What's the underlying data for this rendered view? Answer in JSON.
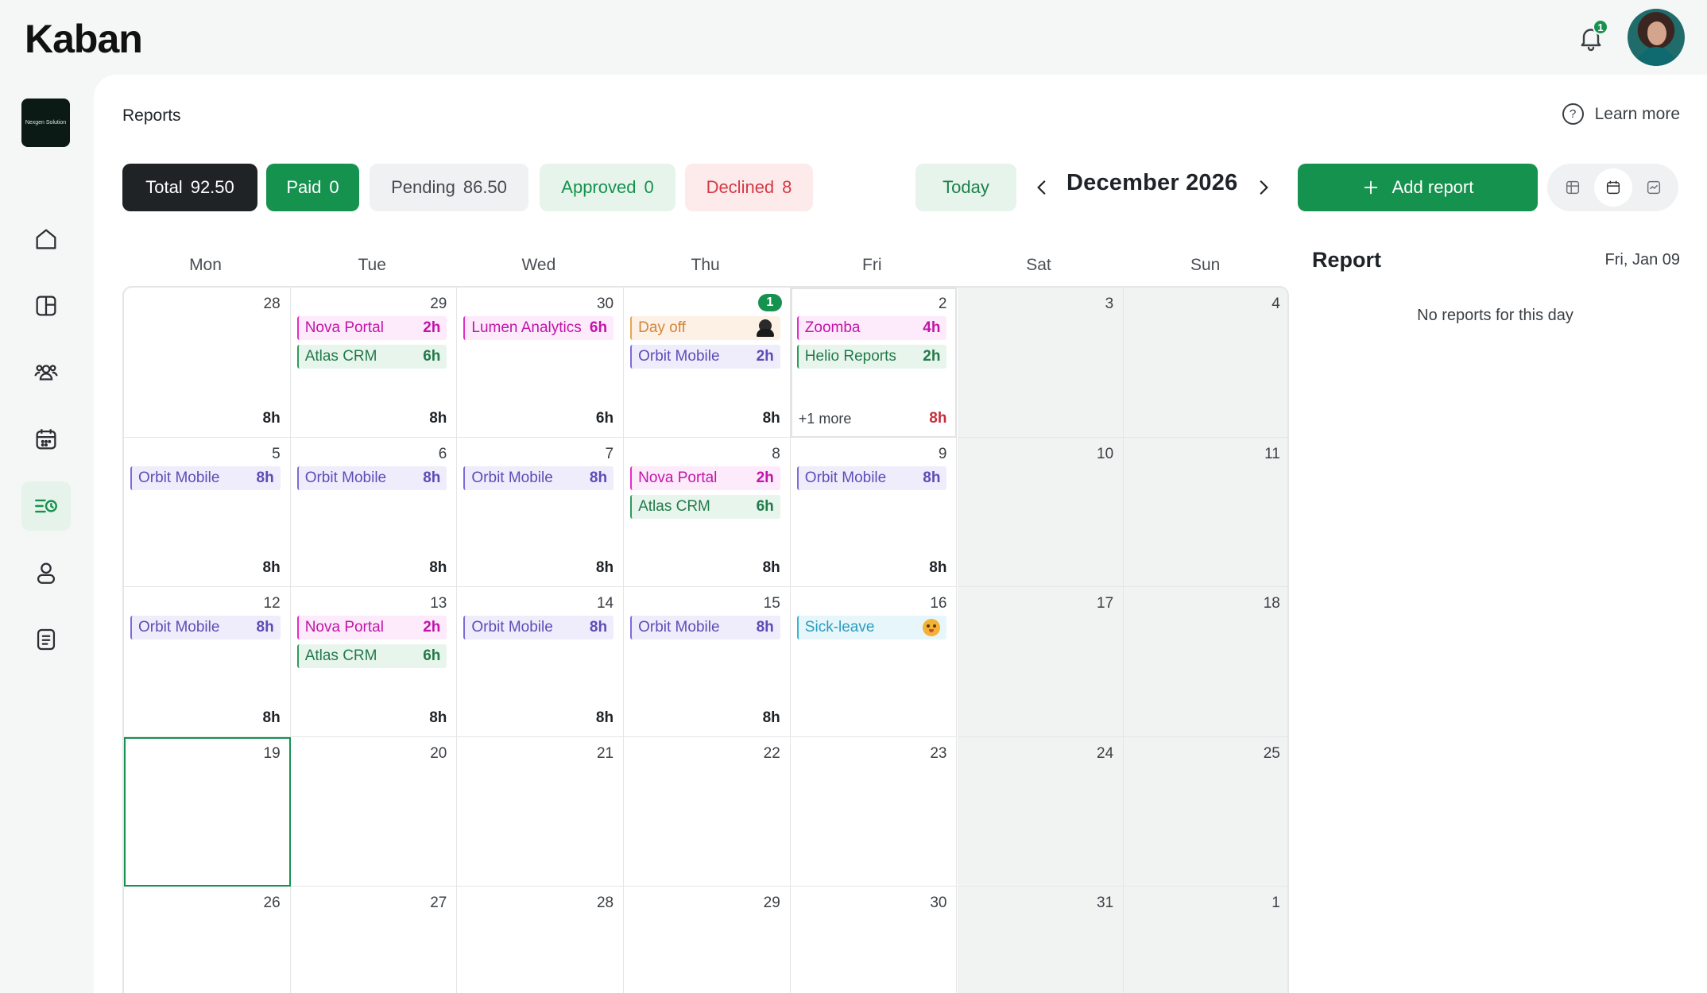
{
  "app": {
    "logo": "Kaban"
  },
  "header": {
    "notifications_count": "1"
  },
  "sidebar": {
    "workspace_label": "Nexgen Solution",
    "items": [
      {
        "name": "home-icon"
      },
      {
        "name": "dashboard-icon"
      },
      {
        "name": "team-icon"
      },
      {
        "name": "calendar-icon"
      },
      {
        "name": "reports-icon",
        "active": true
      },
      {
        "name": "profile-icon"
      },
      {
        "name": "document-icon"
      }
    ]
  },
  "page": {
    "title": "Reports",
    "learn_more": "Learn more"
  },
  "filters": {
    "total": {
      "label": "Total",
      "value": "92.50"
    },
    "paid": {
      "label": "Paid",
      "value": "0"
    },
    "pending": {
      "label": "Pending",
      "value": "86.50"
    },
    "approved": {
      "label": "Approved",
      "value": "0"
    },
    "declined": {
      "label": "Declined",
      "value": "8"
    }
  },
  "toolbar": {
    "today": "Today",
    "month": "December 2026",
    "add_report": "Add report"
  },
  "calendar": {
    "weekdays": [
      "Mon",
      "Tue",
      "Wed",
      "Thu",
      "Fri",
      "Sat",
      "Sun"
    ],
    "weeks": [
      [
        {
          "day": "28",
          "entries": [],
          "total": "8h"
        },
        {
          "day": "29",
          "entries": [
            {
              "kind": "nova",
              "name": "Nova Portal",
              "hours": "2h"
            },
            {
              "kind": "atlas",
              "name": "Atlas CRM",
              "hours": "6h"
            }
          ],
          "total": "8h"
        },
        {
          "day": "30",
          "entries": [
            {
              "kind": "lumen",
              "name": "Lumen Analytics",
              "hours": "6h"
            }
          ],
          "total": "6h"
        },
        {
          "day": "1",
          "today": true,
          "entries": [
            {
              "kind": "dayoff",
              "name": "Day off",
              "emoji": "ninja"
            },
            {
              "kind": "orbit",
              "name": "Orbit Mobile",
              "hours": "2h"
            }
          ],
          "total": "8h"
        },
        {
          "day": "2",
          "focus": true,
          "entries": [
            {
              "kind": "zoomba",
              "name": "Zoomba",
              "hours": "4h"
            },
            {
              "kind": "helio",
              "name": "Helio Reports",
              "hours": "2h"
            }
          ],
          "more": "+1 more",
          "total": "8h",
          "total_red": true
        },
        {
          "day": "3",
          "weekend": true
        },
        {
          "day": "4",
          "weekend": true
        }
      ],
      [
        {
          "day": "5",
          "entries": [
            {
              "kind": "orbit",
              "name": "Orbit Mobile",
              "hours": "8h"
            }
          ],
          "total": "8h"
        },
        {
          "day": "6",
          "entries": [
            {
              "kind": "orbit",
              "name": "Orbit Mobile",
              "hours": "8h"
            }
          ],
          "total": "8h"
        },
        {
          "day": "7",
          "entries": [
            {
              "kind": "orbit",
              "name": "Orbit Mobile",
              "hours": "8h"
            }
          ],
          "total": "8h"
        },
        {
          "day": "8",
          "entries": [
            {
              "kind": "nova",
              "name": "Nova Portal",
              "hours": "2h"
            },
            {
              "kind": "atlas",
              "name": "Atlas CRM",
              "hours": "6h"
            }
          ],
          "total": "8h"
        },
        {
          "day": "9",
          "entries": [
            {
              "kind": "orbit",
              "name": "Orbit Mobile",
              "hours": "8h"
            }
          ],
          "total": "8h"
        },
        {
          "day": "10",
          "weekend": true
        },
        {
          "day": "11",
          "weekend": true
        }
      ],
      [
        {
          "day": "12",
          "entries": [
            {
              "kind": "orbit",
              "name": "Orbit Mobile",
              "hours": "8h"
            }
          ],
          "total": "8h"
        },
        {
          "day": "13",
          "entries": [
            {
              "kind": "nova",
              "name": "Nova Portal",
              "hours": "2h"
            },
            {
              "kind": "atlas",
              "name": "Atlas CRM",
              "hours": "6h"
            }
          ],
          "total": "8h"
        },
        {
          "day": "14",
          "entries": [
            {
              "kind": "orbit",
              "name": "Orbit Mobile",
              "hours": "8h"
            }
          ],
          "total": "8h"
        },
        {
          "day": "15",
          "entries": [
            {
              "kind": "orbit",
              "name": "Orbit Mobile",
              "hours": "8h"
            }
          ],
          "total": "8h"
        },
        {
          "day": "16",
          "entries": [
            {
              "kind": "sick",
              "name": "Sick-leave",
              "emoji": "round"
            }
          ]
        },
        {
          "day": "17",
          "weekend": true
        },
        {
          "day": "18",
          "weekend": true
        }
      ],
      [
        {
          "day": "19",
          "selected": true
        },
        {
          "day": "20"
        },
        {
          "day": "21"
        },
        {
          "day": "22"
        },
        {
          "day": "23"
        },
        {
          "day": "24",
          "weekend": true
        },
        {
          "day": "25",
          "weekend": true
        }
      ],
      [
        {
          "day": "26"
        },
        {
          "day": "27"
        },
        {
          "day": "28"
        },
        {
          "day": "29"
        },
        {
          "day": "30"
        },
        {
          "day": "31",
          "weekend": true
        },
        {
          "day": "1",
          "weekend": true
        }
      ]
    ]
  },
  "report_panel": {
    "title": "Report",
    "date": "Fri, Jan 09",
    "empty_message": "No reports for this day"
  },
  "colors": {
    "brand_green": "#16924f",
    "declined_red": "#d43a47"
  }
}
